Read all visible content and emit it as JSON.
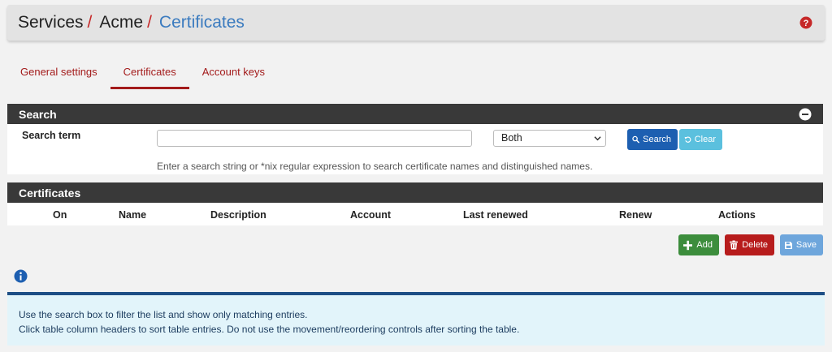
{
  "breadcrumb": {
    "items": [
      "Services",
      "Acme"
    ],
    "separator": "/",
    "current": "Certificates"
  },
  "tabs": [
    {
      "label": "General settings",
      "active": false
    },
    {
      "label": "Certificates",
      "active": true
    },
    {
      "label": "Account keys",
      "active": false
    }
  ],
  "search_panel": {
    "title": "Search",
    "label": "Search term",
    "input_value": "",
    "select_value": "Both",
    "search_button": "Search",
    "clear_button": "Clear",
    "help_text": "Enter a search string or *nix regular expression to search certificate names and distinguished names."
  },
  "certificates_panel": {
    "title": "Certificates",
    "columns": [
      "On",
      "Name",
      "Description",
      "Account",
      "Last renewed",
      "Renew",
      "Actions"
    ],
    "rows": []
  },
  "actions": {
    "add": "Add",
    "delete": "Delete",
    "save": "Save"
  },
  "info": {
    "lines": [
      "Use the search box to filter the list and show only matching entries.",
      "Click table column headers to sort table entries. Do not use the movement/reordering controls after sorting the table."
    ]
  },
  "colors": {
    "accent_red": "#a31b1b",
    "link_blue": "#3b7bbf",
    "panel_dark": "#393939",
    "info_border": "#1d4e85"
  }
}
